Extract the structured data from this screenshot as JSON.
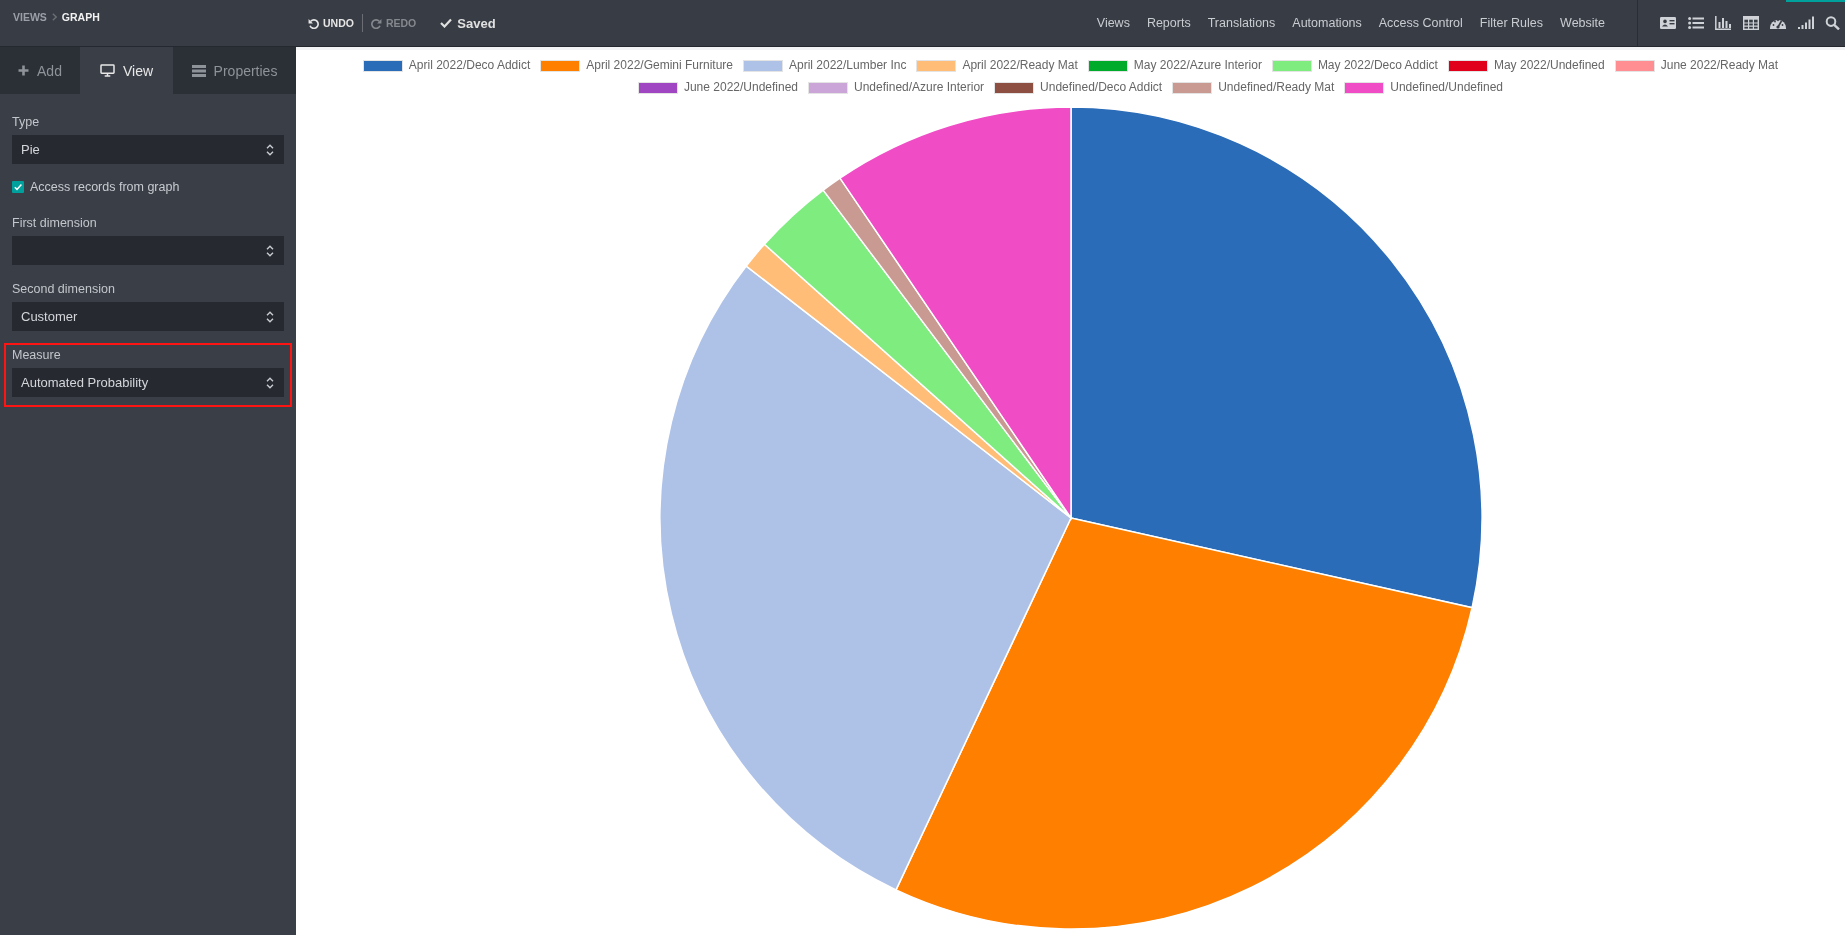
{
  "breadcrumbs": [
    {
      "label": "VIEWS",
      "current": false
    },
    {
      "label": "GRAPH",
      "current": true
    }
  ],
  "toolbar": {
    "actions": [
      {
        "kind": "undo",
        "label": "UNDO",
        "disabled": false
      },
      {
        "kind": "redo",
        "label": "REDO",
        "disabled": true
      }
    ],
    "status": "Saved"
  },
  "menu": [
    "Views",
    "Reports",
    "Translations",
    "Automations",
    "Access Control",
    "Filter Rules",
    "Website"
  ],
  "sidebar": {
    "tabs": [
      {
        "kind": "add",
        "label": "Add",
        "selected": false
      },
      {
        "kind": "view",
        "label": "View",
        "selected": true
      },
      {
        "kind": "properties",
        "label": "Properties",
        "selected": false
      }
    ],
    "fields": [
      {
        "kind": "select",
        "label": "Type",
        "value": "Pie",
        "highlighted": false
      },
      {
        "kind": "checkbox",
        "label": "Access records from graph",
        "checked": true
      },
      {
        "kind": "select",
        "label": "First dimension",
        "highlighted": false
      },
      {
        "kind": "select",
        "label": "Second dimension",
        "value": "Customer",
        "highlighted": false
      },
      {
        "kind": "select",
        "label": "Measure",
        "value": "Automated Probability",
        "highlighted": true
      }
    ]
  },
  "graph": {
    "chart_data": {
      "type": "pie",
      "legend": "top",
      "categories": [
        "April 2022/Deco Addict",
        "April 2022/Gemini Furniture",
        "April 2022/Lumber Inc",
        "April 2022/Ready Mat",
        "May 2022/Azure Interior",
        "May 2022/Deco Addict",
        "May 2022/Undefined",
        "June 2022/Ready Mat",
        "June 2022/Undefined",
        "Undefined/Azure Interior",
        "Undefined/Deco Addict",
        "Undefined/Ready Mat",
        "Undefined/Undefined"
      ],
      "values": [
        28.5,
        28.5,
        28.5,
        1.1,
        0,
        3.1,
        0,
        0,
        0,
        0,
        0,
        0.8,
        9.5
      ],
      "colors": [
        "#2b6cb8",
        "#ff7f00",
        "#aec2e8",
        "#ffbd78",
        "#00ab2b",
        "#7fec80",
        "#e0001b",
        "#ff8e92",
        "#a046c2",
        "#cca5d8",
        "#8e4f43",
        "#c99a92",
        "#f04cc6"
      ]
    }
  }
}
